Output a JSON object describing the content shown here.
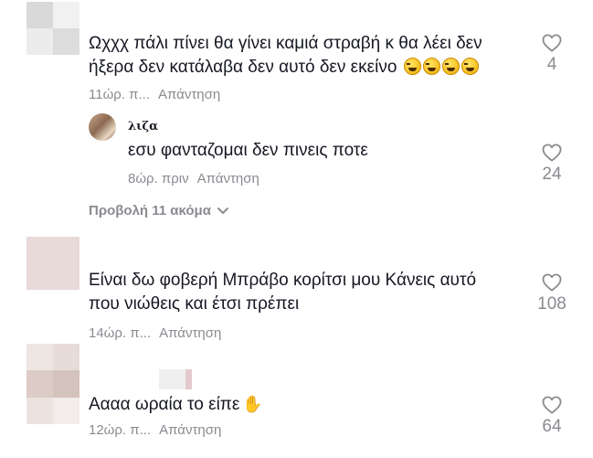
{
  "comments": [
    {
      "line1": "Ωχχχ πάλι πίνει θα γίνει καμιά στραβή κ θα λέει δεν",
      "line2": "ήξερα δεν κατάλαβα δεν αυτό δεν εκείνο",
      "time": "11ώρ. π...",
      "reply": "Απάντηση",
      "likes": "4",
      "emoji": "rolling-on-floor-laughing-icon"
    },
    {
      "username": "λιζα",
      "text": "εσυ φανταζομαι δεν πινεις ποτε",
      "time": "8ώρ. πριν",
      "reply": "Απάντηση",
      "likes": "24"
    },
    {
      "line1": "Είναι δω φοβερή Μπράβο κορίτσι μου Κάνεις αυτό",
      "line2": "που νιώθεις και έτσι πρέπει",
      "time": "14ώρ. π...",
      "reply": "Απάντηση",
      "likes": "108"
    },
    {
      "text": "Αααα ωραία το είπε",
      "time": "12ώρ. π...",
      "reply": "Απάντηση",
      "likes": "64",
      "emoji": "clapping-hands-icon"
    }
  ],
  "view_more": {
    "label": "Προβολή 11 ακόμα"
  },
  "colors": {
    "text": "#161823",
    "muted": "#8a8b91",
    "heart_stroke": "#8a8b91"
  }
}
